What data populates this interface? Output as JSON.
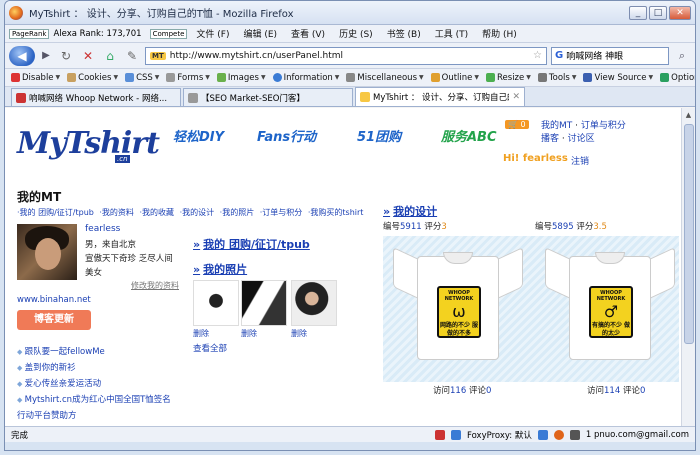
{
  "window": {
    "title": "MyTshirt ： 设计、分享、订购自己的T恤 - Mozilla Firefox",
    "minimize": "_",
    "maximize": "□",
    "close": "✕"
  },
  "menubar": {
    "pagerank": "PageRank",
    "alexa": "Alexa Rank: 173,701",
    "compete": "Compete",
    "items": [
      "文件 (F)",
      "编辑 (E)",
      "查看 (V)",
      "历史 (S)",
      "书签 (B)",
      "工具 (T)",
      "帮助 (H)"
    ]
  },
  "navbar": {
    "url": "http://www.mytshirt.cn/userPanel.html",
    "favicon": "MT",
    "search_value": "响喊网络 神眼",
    "search_engine": "G"
  },
  "toolbar": {
    "items": [
      "Disable",
      "Cookies",
      "CSS",
      "Forms",
      "Images",
      "Information",
      "Miscellaneous",
      "Outline",
      "Resize",
      "Tools",
      "View Source",
      "Options"
    ]
  },
  "tabs": [
    {
      "label": "响喊网络 Whoop Network - 网络...",
      "active": false
    },
    {
      "label": "【SEO Market-SEO门客】",
      "active": false
    },
    {
      "label": "MyTshirt ： 设计、分享、订购自己的...",
      "active": true
    }
  ],
  "site": {
    "logo": "MyTshirt",
    "logo_sub": ".cn",
    "slogans": [
      "轻松DIY",
      "Fans行动",
      "51团购",
      "服务ABC"
    ],
    "cart_count": "0",
    "top_links": [
      "我的MT",
      "订单与积分",
      "播客",
      "讨论区"
    ],
    "greeting": "Hi! fearless",
    "logout": "注销"
  },
  "profile": {
    "title": "我的MT",
    "tabs": [
      "·我的 团购/征订/tpub",
      "·我的资料",
      "·我的收藏",
      "·我的设计",
      "·我的照片",
      "·订单与积分",
      "·我购买的tshirt"
    ],
    "name": "fearless",
    "lines": [
      "男，来自北京",
      "宣傲天下奇珍 乏尽人间",
      "美女"
    ],
    "edit": "修改我的资料",
    "blog_url": "www.binahan.net",
    "blog_button": "博客更新",
    "news": [
      {
        "text": "跟队要一起fellowMe",
        "plain": false
      },
      {
        "text": "盖到你的新衫",
        "plain": false
      },
      {
        "text": "爱心传丝亲爱运活动",
        "plain": false
      },
      {
        "text": "Mytshirt.cn成为红心中国全国T恤签名",
        "plain": false
      },
      {
        "text": "行动平台赞助方",
        "plain": true
      }
    ]
  },
  "middle": {
    "arrows": "»",
    "group_heading": "我的 团购/征订/tpub",
    "photo_heading": "我的照片",
    "delete_label": "删除",
    "view_all": "查看全部"
  },
  "designs": {
    "arrows": "»",
    "heading": "我的设计",
    "items": [
      {
        "num_label": "编号",
        "num": "5911",
        "score_label": "评分",
        "score": "3",
        "print_top": "WHOOP NETWORK",
        "print_icon": "ω",
        "print_bottom": "网路的不少 服做的不多",
        "visits_label": "访问",
        "visits": "116",
        "comments_label": "评论",
        "comments": "0"
      },
      {
        "num_label": "编号",
        "num": "5895",
        "score_label": "评分",
        "score": "3.5",
        "print_top": "WHOOP NETWORK",
        "print_icon": "♂",
        "print_bottom": "有搞的不少 做的太少",
        "visits_label": "访问",
        "visits": "114",
        "comments_label": "评论",
        "comments": "0"
      }
    ]
  },
  "statusbar": {
    "left": "完成",
    "proxy": "FoxyProxy: 默认",
    "mail": "1 pnuo.com@gmail.com"
  }
}
